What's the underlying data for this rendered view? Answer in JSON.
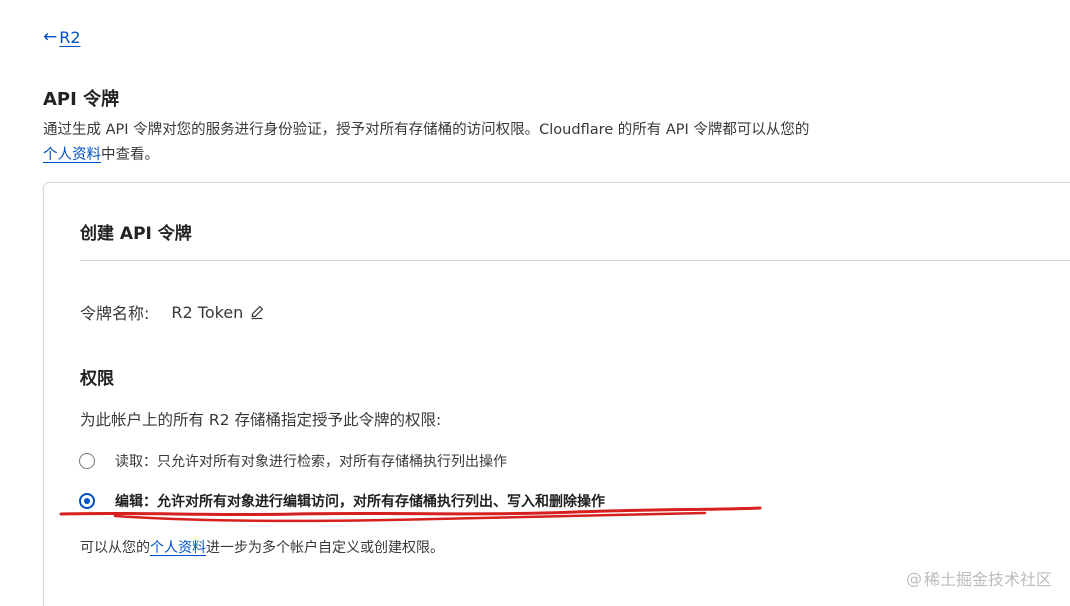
{
  "breadcrumb": {
    "back_arrow": "←",
    "label": "R2"
  },
  "section": {
    "title": "API 令牌",
    "desc_text": "通过生成 API 令牌对您的服务进行身份验证，授予对所有存储桶的访问权限。Cloudflare 的所有 API 令牌都可以从您的",
    "desc_link": "个人资料",
    "desc_tail": "中查看。"
  },
  "card": {
    "title": "创建 API 令牌",
    "token_label": "令牌名称:",
    "token_value": "R2 Token",
    "edit_icon": "pencil-icon",
    "permissions_title": "权限",
    "permissions_desc": "为此帐户上的所有 R2 存储桶指定授予此令牌的权限:",
    "options": [
      {
        "label": "读取：只允许对所有对象进行检索，对所有存储桶执行列出操作",
        "checked": false
      },
      {
        "label": "编辑：允许对所有对象进行编辑访问，对所有存储桶执行列出、写入和删除操作",
        "checked": true
      }
    ],
    "footer_prefix": "可以从您的",
    "footer_link": "个人资料",
    "footer_suffix": "进一步为多个帐户自定义或创建权限。"
  },
  "watermark": {
    "at": "@",
    "text": "稀土掘金技术社区"
  },
  "colors": {
    "link": "#0051c3",
    "annotation": "#d62020"
  }
}
